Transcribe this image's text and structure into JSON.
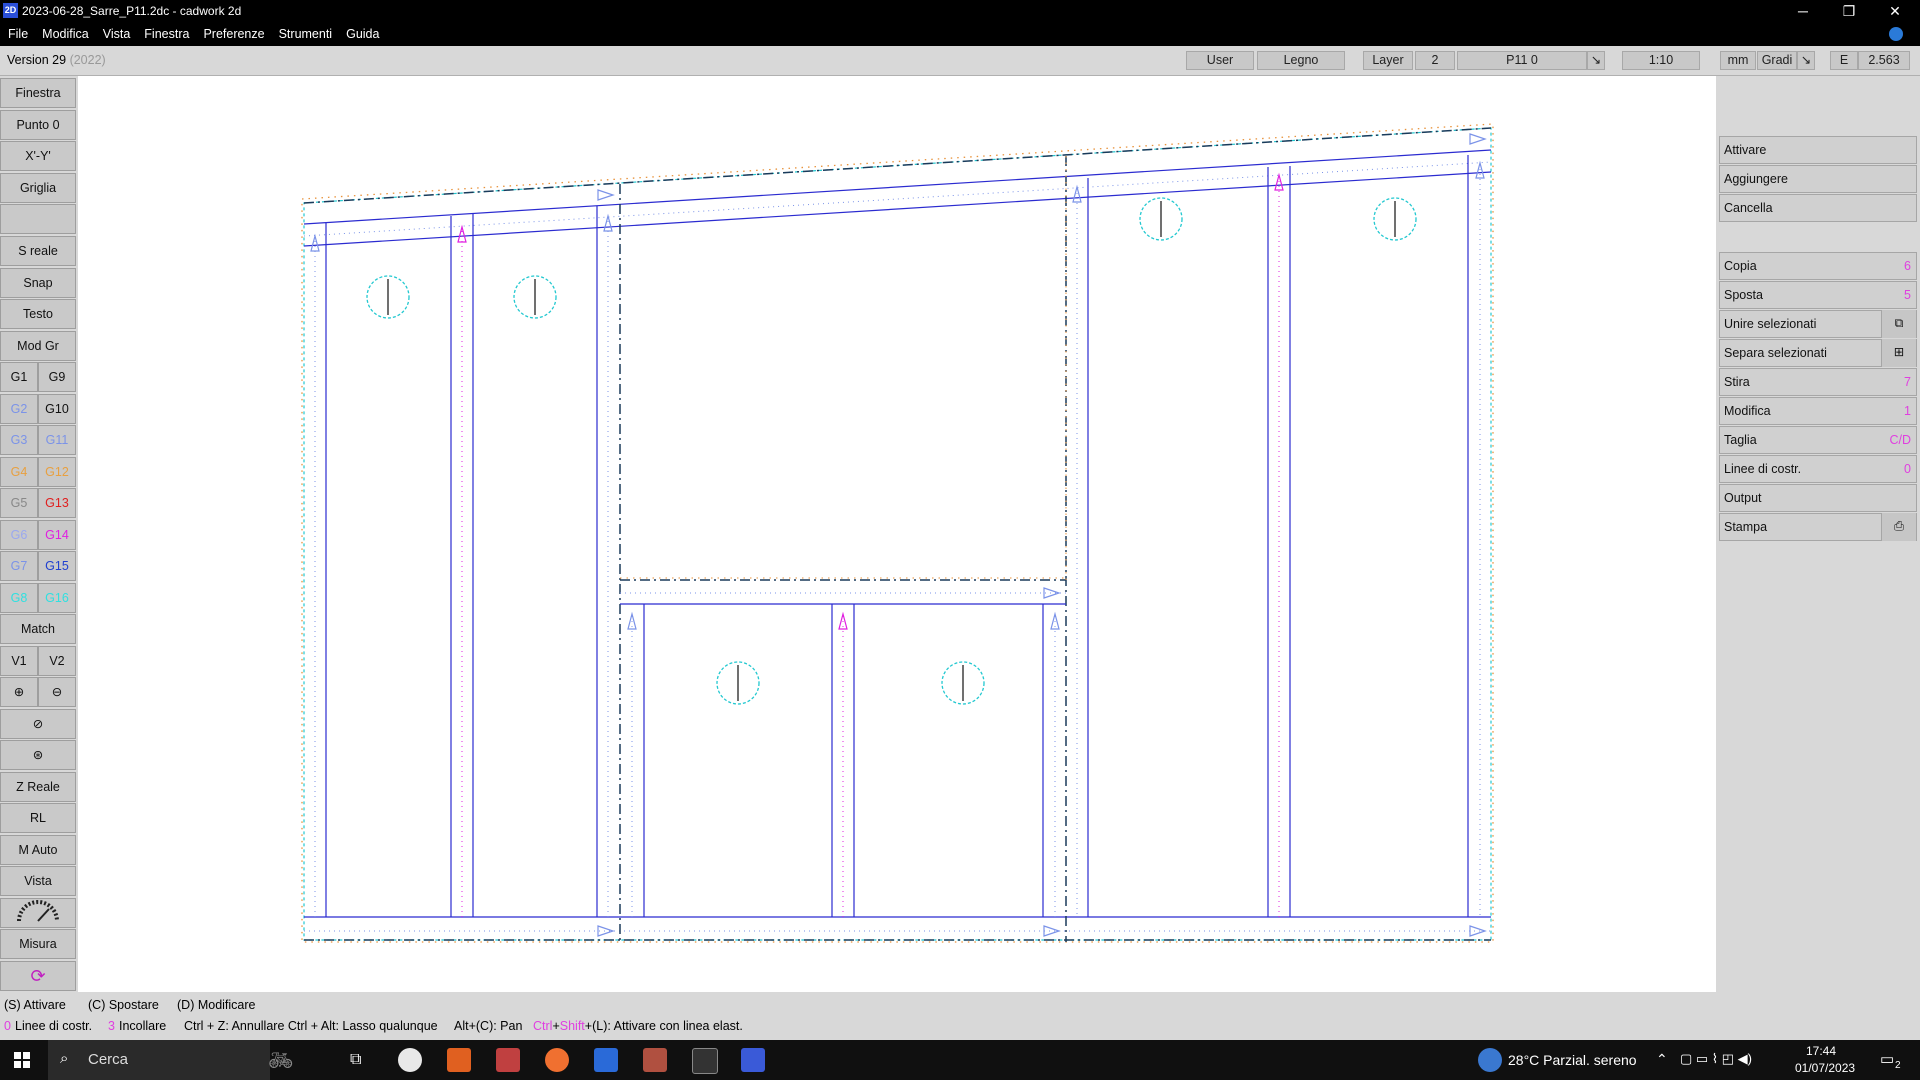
{
  "window": {
    "title": "2023-06-28_Sarre_P11.2dc - cadwork 2d",
    "app_icon_text": "2D",
    "minimize": "─",
    "restore": "❐",
    "close": "✕"
  },
  "menu": [
    "File",
    "Modifica",
    "Vista",
    "Finestra",
    "Preferenze",
    "Strumenti",
    "Guida"
  ],
  "infobar": {
    "version": "Version 29",
    "version_year": "(2022)",
    "user": "User",
    "material": "Legno",
    "layer_label": "Layer",
    "layer_value": "2",
    "layer_name": "P11 0",
    "scale": "1:10",
    "unit": "mm",
    "angle_unit": "Gradi",
    "e_label": "E",
    "e_value": "2.563"
  },
  "left_toolbar": {
    "finestra": "Finestra",
    "punto0": "Punto 0",
    "xy": "X'-Y'",
    "griglia": "Griglia",
    "sreale": "S reale",
    "snap": "Snap",
    "testo": "Testo",
    "modgr": "Mod Gr",
    "groups_left": [
      "G1",
      "G2",
      "G3",
      "G4",
      "G5",
      "G6",
      "G7",
      "G8"
    ],
    "groups_right": [
      "G9",
      "G10",
      "G11",
      "G12",
      "G13",
      "G14",
      "G15",
      "G16"
    ],
    "groups_left_colors": [
      "#111111",
      "#7b93e8",
      "#7b93e8",
      "#e8a040",
      "#888888",
      "#9aa8f0",
      "#7b93e8",
      "#30e0e0"
    ],
    "groups_right_colors": [
      "#111111",
      "#111111",
      "#7b93e8",
      "#e8a040",
      "#e02020",
      "#e020e0",
      "#2040d0",
      "#30e0e0"
    ],
    "match": "Match",
    "v1": "V1",
    "v2": "V2",
    "zreale": "Z Reale",
    "rl": "RL",
    "mauto": "M Auto",
    "vista": "Vista",
    "misura": "Misura"
  },
  "right_panel": {
    "attivare": "Attivare",
    "aggiungere": "Aggiungere",
    "cancella": "Cancella",
    "copia": "Copia",
    "copia_key": "6",
    "sposta": "Sposta",
    "sposta_key": "5",
    "unire": "Unire selezionati",
    "separa": "Separa selezionati",
    "stira": "Stira",
    "stira_key": "7",
    "modifica": "Modifica",
    "modifica_key": "1",
    "taglia": "Taglia",
    "taglia_key": "C/D",
    "linee": "Linee di costr.",
    "linee_key": "0",
    "output": "Output",
    "stampa": "Stampa"
  },
  "status": {
    "line1": [
      "(S) Attivare",
      "(C) Spostare",
      "(D) Modificare"
    ],
    "l2_k1": "0",
    "l2_t1": "Linee di costr.",
    "l2_k2": "3",
    "l2_t2": "Incollare",
    "l2_t3": "Ctrl + Z: Annullare Ctrl + Alt: Lasso qualunque",
    "l2_t4": "Alt+(C): Pan",
    "l2_ctrl": "Ctrl",
    "l2_plus": "+",
    "l2_shift": "Shift",
    "l2_t5": "+(L): Attivare con linea elast."
  },
  "taskbar": {
    "search": "Cerca",
    "weather": "28°C  Parzial. sereno",
    "time": "17:44",
    "date": "01/07/2023",
    "notif_count": "2"
  },
  "colors": {
    "frame": "#2b2bd0",
    "outline": "#e8923a",
    "cyan": "#22c8d0",
    "magenta": "#e020e0"
  }
}
